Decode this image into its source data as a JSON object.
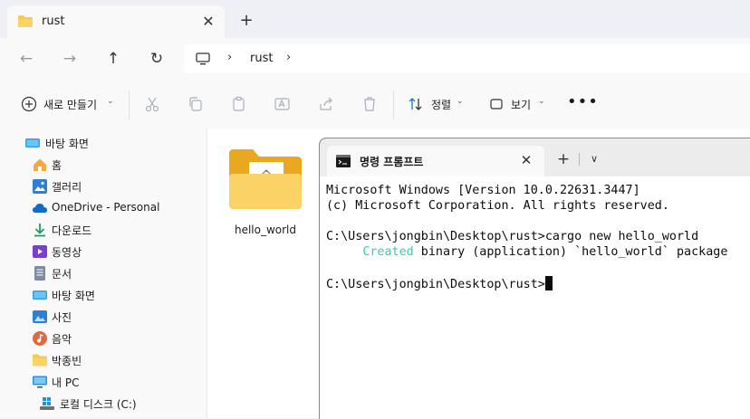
{
  "explorer": {
    "tab": {
      "title": "rust"
    },
    "address": {
      "segments": [
        "rust"
      ]
    },
    "toolbar": {
      "new_label": "새로 만들기",
      "sort_label": "정렬",
      "view_label": "보기"
    },
    "sidebar": {
      "items": [
        {
          "label": "바탕 화면",
          "icon": "desktop-icon"
        },
        {
          "label": "홈",
          "icon": "home-icon"
        },
        {
          "label": "갤러리",
          "icon": "gallery-icon"
        },
        {
          "label": "OneDrive - Personal",
          "icon": "cloud-icon"
        },
        {
          "label": "다운로드",
          "icon": "download-icon"
        },
        {
          "label": "동영상",
          "icon": "video-icon"
        },
        {
          "label": "문서",
          "icon": "document-icon"
        },
        {
          "label": "바탕 화면",
          "icon": "desktop-icon"
        },
        {
          "label": "사진",
          "icon": "pictures-icon"
        },
        {
          "label": "음악",
          "icon": "music-icon"
        },
        {
          "label": "박종빈",
          "icon": "folder-icon"
        },
        {
          "label": "내 PC",
          "icon": "pc-icon"
        },
        {
          "label": "로컬 디스크 (C:)",
          "icon": "drive-icon"
        }
      ]
    },
    "files": [
      {
        "name": "hello_world",
        "type": "folder"
      }
    ]
  },
  "terminal": {
    "tab_title": "명령 프롬프트",
    "lines": [
      "Microsoft Windows [Version 10.0.22631.3447]",
      "(c) Microsoft Corporation. All rights reserved.",
      "",
      "C:\\Users\\jongbin\\Desktop\\rust>cargo new hello_world"
    ],
    "created_word": "Created",
    "created_rest": " binary (application) `hello_world` package",
    "prompt": "C:\\Users\\jongbin\\Desktop\\rust>"
  },
  "colors": {
    "folder": "#f8c94a",
    "created_text": "#3fc7b0",
    "accent": "#1a73d9"
  }
}
